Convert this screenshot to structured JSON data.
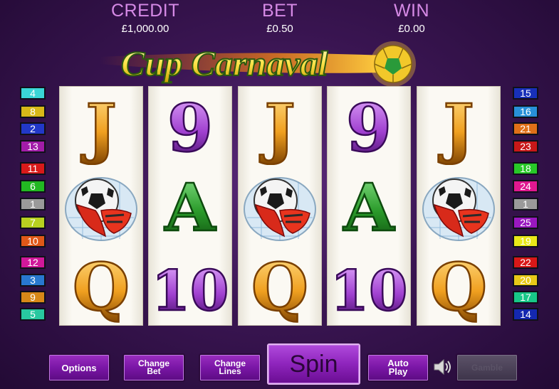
{
  "meters": {
    "credit": {
      "label": "CREDIT",
      "value": "£1,000.00"
    },
    "bet": {
      "label": "BET",
      "value": "£0.50"
    },
    "win": {
      "label": "WIN",
      "value": "£0.00"
    }
  },
  "logo": {
    "text": "Cup Carnaval",
    "ball_icon": "football-icon"
  },
  "reels": [
    [
      "J",
      "goalkeeper-ball-gloves",
      "Q"
    ],
    [
      "9",
      "A",
      "10"
    ],
    [
      "J",
      "goalkeeper-ball-gloves",
      "Q"
    ],
    [
      "9",
      "A",
      "10"
    ],
    [
      "J",
      "goalkeeper-ball-gloves",
      "Q"
    ]
  ],
  "symbol_colors": {
    "J": "#f0a020",
    "Q": "#f0a020",
    "9": "#a040d0",
    "10": "#a040d0",
    "A": "#2a9a2a"
  },
  "lines_left": [
    {
      "n": "4",
      "color": "#3ad6d6"
    },
    {
      "n": "8",
      "color": "#d8b818"
    },
    {
      "n": "2",
      "color": "#2238c8"
    },
    {
      "n": "13",
      "color": "#a21ca8"
    },
    {
      "n": "11",
      "color": "#d81a1a"
    },
    {
      "n": "6",
      "color": "#22b822"
    },
    {
      "n": "1",
      "color": "#9a9a9a"
    },
    {
      "n": "7",
      "color": "#b8d020"
    },
    {
      "n": "10",
      "color": "#e05818"
    },
    {
      "n": "12",
      "color": "#d0189a"
    },
    {
      "n": "3",
      "color": "#2878d0"
    },
    {
      "n": "9",
      "color": "#d88818"
    },
    {
      "n": "5",
      "color": "#28c8a0"
    }
  ],
  "lines_right": [
    {
      "n": "15",
      "color": "#1830b8"
    },
    {
      "n": "16",
      "color": "#2890d8"
    },
    {
      "n": "21",
      "color": "#e07018"
    },
    {
      "n": "23",
      "color": "#c81818"
    },
    {
      "n": "18",
      "color": "#28c828"
    },
    {
      "n": "24",
      "color": "#e01890"
    },
    {
      "n": "1",
      "color": "#9a9a9a"
    },
    {
      "n": "25",
      "color": "#9a18c0"
    },
    {
      "n": "19",
      "color": "#e8e818"
    },
    {
      "n": "22",
      "color": "#d81818"
    },
    {
      "n": "20",
      "color": "#e8c818"
    },
    {
      "n": "17",
      "color": "#18c888"
    },
    {
      "n": "14",
      "color": "#1428b0"
    }
  ],
  "buttons": {
    "options": "Options",
    "change_bet": "Change\nBet",
    "change_lines": "Change\nLines",
    "spin": "Spin",
    "auto_play": "Auto\nPlay",
    "gamble": "Gamble",
    "sound_icon": "speaker-icon"
  }
}
